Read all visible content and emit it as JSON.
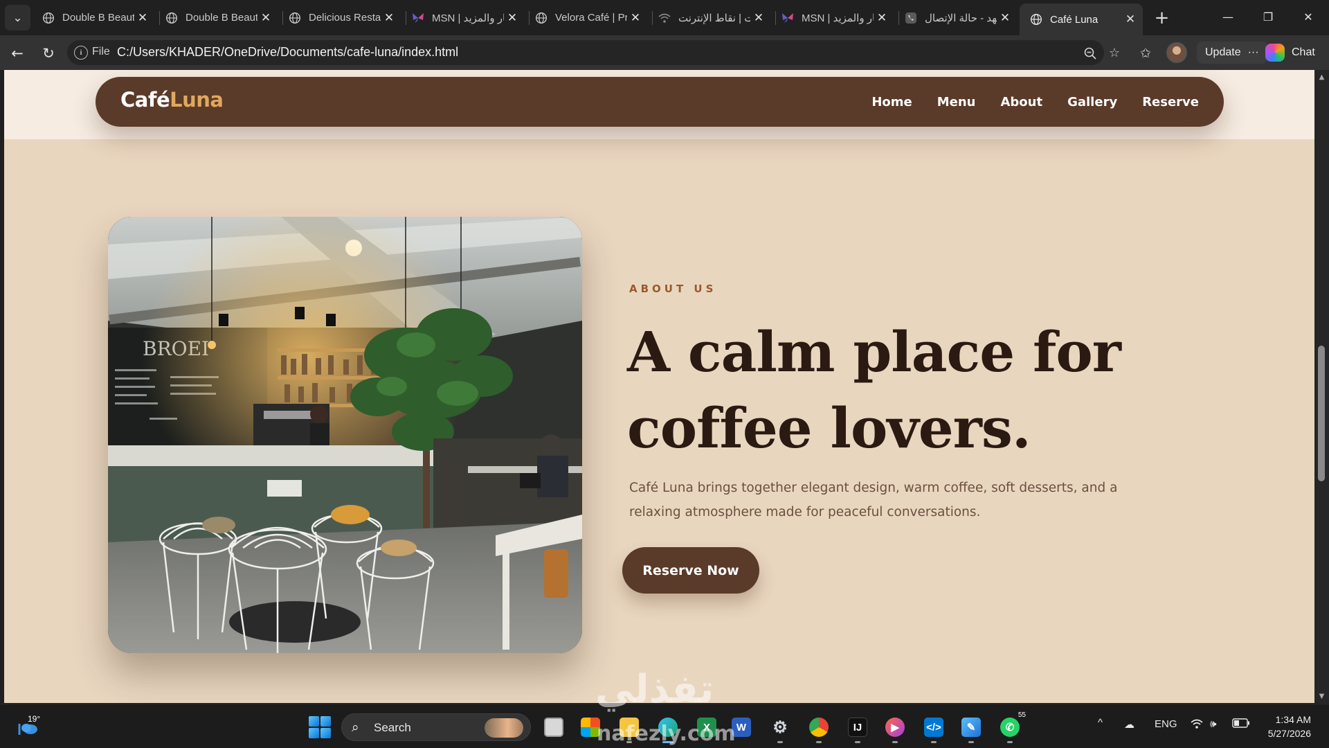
{
  "browser": {
    "tabs": [
      {
        "title": "Double B Beauty",
        "icon": "globe-icon",
        "active": false
      },
      {
        "title": "Double B Beauty",
        "icon": "globe-icon",
        "active": false
      },
      {
        "title": "Delicious Restaurant",
        "icon": "globe-icon",
        "active": false
      },
      {
        "title": "MSN | الأخبار والمزيد",
        "icon": "msn-butterfly-icon",
        "active": false
      },
      {
        "title": "Velora Café | Premium",
        "icon": "globe-icon",
        "active": false
      },
      {
        "title": "علي نت | نقاط الإنترنت",
        "icon": "wifi-icon",
        "active": false
      },
      {
        "title": "MSN | الأخبار والمزيد",
        "icon": "msn-butterfly-icon",
        "active": false
      },
      {
        "title": "الفهد - حالة الإتصال",
        "icon": "phone-icon",
        "active": false
      },
      {
        "title": "Café Luna",
        "icon": "globe-icon",
        "active": true
      }
    ],
    "close_glyph": "✕",
    "address": {
      "scheme_label": "File",
      "url": "C:/Users/KHADER/OneDrive/Documents/cafe-luna/index.html"
    },
    "update_label": "Update",
    "more_glyph": "···",
    "chat_label": "Chat"
  },
  "site": {
    "logo": {
      "primary": "Café",
      "accent": "Luna"
    },
    "nav": [
      "Home",
      "Menu",
      "About",
      "Gallery",
      "Reserve"
    ],
    "about": {
      "kicker": "ABOUT US",
      "title_line1": "A calm place for",
      "title_line2": "coffee lovers.",
      "body_line1": "Café Luna brings together elegant design, warm coffee, soft desserts, and a",
      "body_line2": "relaxing atmosphere made for peaceful conversations.",
      "cta": "Reserve Now"
    },
    "colors": {
      "header_bg": "#f6ece2",
      "page_bg": "#e9d6bf",
      "navbar_bg": "#5a3a29",
      "logo_accent": "#e0a85c",
      "kicker": "#9a5a2a",
      "title": "#2a1a12",
      "body_text": "#6b4f3f"
    }
  },
  "taskbar": {
    "weather_temp": "19°",
    "search_label": "Search",
    "language": "ENG",
    "time": "1:34 AM",
    "date": "5/27/2026",
    "whatsapp_badge": "55"
  },
  "watermark": {
    "big": "تفذلي",
    "small": "nafezly.com"
  }
}
